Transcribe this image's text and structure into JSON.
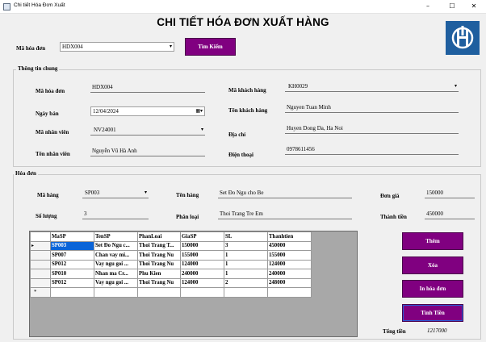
{
  "window": {
    "title": "Chi tiết Hóa Đơn Xuất",
    "min_glyph": "–",
    "max_glyph": "☐",
    "close_glyph": "✕"
  },
  "heading": "CHI TIẾT HÓA ĐƠN XUẤT HÀNG",
  "search": {
    "label": "Mã hóa đơn",
    "value": "HDX004",
    "button": "Tìm Kiếm"
  },
  "general": {
    "title": "Thông tin chung",
    "invoice_label": "Mã hóa đơn",
    "invoice_value": "HDX004",
    "date_label": "Ngày bán",
    "date_value": "12/04/2024",
    "staff_id_label": "Mã nhân viên",
    "staff_id_value": "NV24001",
    "staff_name_label": "Tên nhân viên",
    "staff_name_value": "Nguyễn Vũ Hà Anh",
    "cust_id_label": "Mã khách hàng",
    "cust_id_value": "KH0029",
    "cust_name_label": "Tên khách hàng",
    "cust_name_value": "Nguyen Tuan Minh",
    "address_label": "Địa chỉ",
    "address_value": "Huyen Dong Da, Ha Noi",
    "phone_label": "Điện thoại",
    "phone_value": "0978611456"
  },
  "invoice": {
    "title": "Hóa đơn",
    "item_id_label": "Mã hàng",
    "item_id_value": "SP003",
    "qty_label": "Số lượng",
    "qty_value": "3",
    "item_name_label": "Tên hàng",
    "item_name_value": "Set Đo Ngu cho Be",
    "category_label": "Phân loại",
    "category_value": "Thoi Trang Tre Em",
    "price_label": "Đơn giá",
    "price_value": "150000",
    "amount_label": "Thành tiền",
    "amount_value": "450000"
  },
  "table": {
    "columns": [
      "MaSP",
      "TenSP",
      "PhanLoai",
      "GiaSP",
      "SL",
      "Thanhtien"
    ],
    "row_marker": "▸",
    "new_marker": "*",
    "rows": [
      [
        "SP003",
        "Set Đo Ngu c...",
        "Thoi Trang T...",
        "150000",
        "3",
        "450000"
      ],
      [
        "SP007",
        "Chan vay mi...",
        "Thoi Trang Nu",
        "155000",
        "1",
        "155000"
      ],
      [
        "SP012",
        "Vay ngu goi ...",
        "Thoi Trang Nu",
        "124000",
        "1",
        "124000"
      ],
      [
        "SP010",
        "Nhan ma Cr...",
        "Phu Kien",
        "240000",
        "1",
        "240000"
      ],
      [
        "SP012",
        "Vay ngu goi ...",
        "Thoi Trang Nu",
        "124000",
        "2",
        "248000"
      ]
    ]
  },
  "buttons": {
    "add": "Thêm",
    "delete": "Xóa",
    "print": "In hóa đơn",
    "calc": "Tính Tiền"
  },
  "total": {
    "label": "Tổng tiền",
    "value": "1217000"
  },
  "colors": {
    "button": "#800080",
    "logo": "#1f5f9f",
    "selection": "#0a64d8"
  }
}
